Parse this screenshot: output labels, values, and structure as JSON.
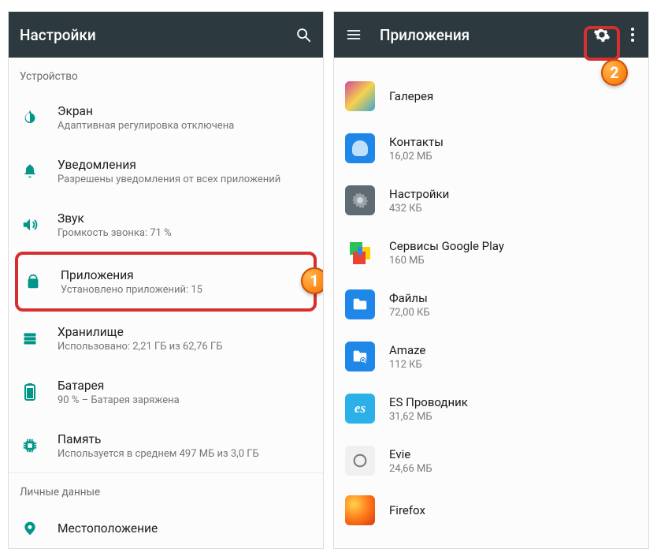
{
  "left": {
    "title": "Настройки",
    "sections": {
      "device": "Устройство",
      "personal": "Личные данные"
    },
    "items": {
      "display": {
        "title": "Экран",
        "subtitle": "Адаптивная регулировка отключена"
      },
      "notifications": {
        "title": "Уведомления",
        "subtitle": "Разрешены уведомления от всех приложений"
      },
      "sound": {
        "title": "Звук",
        "subtitle": "Громкость звонка: 71 %"
      },
      "apps": {
        "title": "Приложения",
        "subtitle": "Установлено приложений: 15"
      },
      "storage": {
        "title": "Хранилище",
        "subtitle": "Использовано: 2,21 ГБ из 62,76 ГБ"
      },
      "battery": {
        "title": "Батарея",
        "subtitle": "90 % – Батарея заряжена"
      },
      "memory": {
        "title": "Память",
        "subtitle": "Используется в среднем 497 МБ из 3,0 ГБ"
      },
      "location": {
        "title": "Местоположение"
      }
    }
  },
  "right": {
    "title": "Приложения",
    "apps": {
      "gallery": {
        "name": "Галерея",
        "size": ""
      },
      "contacts": {
        "name": "Контакты",
        "size": "16,02 МБ"
      },
      "settings": {
        "name": "Настройки",
        "size": "432 КБ"
      },
      "play": {
        "name": "Сервисы Google Play",
        "size": "160 МБ"
      },
      "files": {
        "name": "Файлы",
        "size": "72,00 КБ"
      },
      "amaze": {
        "name": "Amaze",
        "size": "112 КБ"
      },
      "es": {
        "name": "ES Проводник",
        "size": "31,62 МБ"
      },
      "evie": {
        "name": "Evie",
        "size": "24,66 МБ"
      },
      "firefox": {
        "name": "Firefox",
        "size": ""
      }
    }
  },
  "badges": {
    "one": "1",
    "two": "2"
  }
}
